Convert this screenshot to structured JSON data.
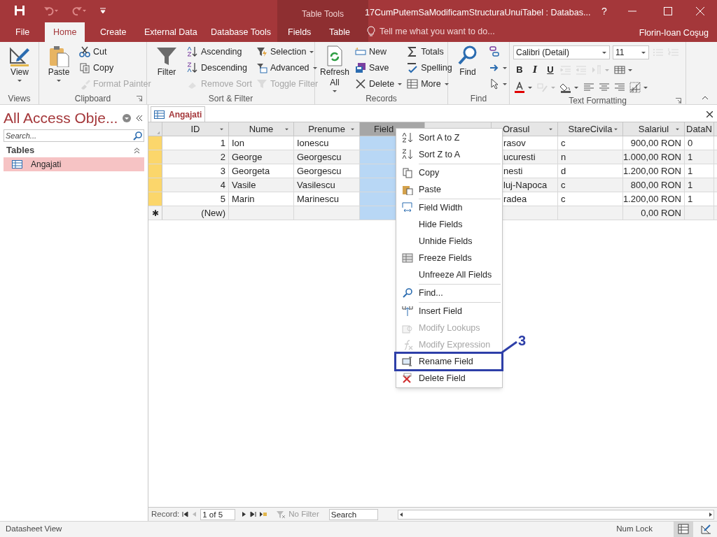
{
  "title_bar": {
    "title": "17CumPutemSaModificamStructuraUnuiTabel : Databas...",
    "contextual_group": "Table Tools",
    "help": "?"
  },
  "menu_tabs": [
    {
      "label": "File",
      "selected": false
    },
    {
      "label": "Home",
      "selected": true
    },
    {
      "label": "Create",
      "selected": false
    },
    {
      "label": "External Data",
      "selected": false
    },
    {
      "label": "Database Tools",
      "selected": false
    },
    {
      "label": "Fields",
      "selected": false
    },
    {
      "label": "Table",
      "selected": false
    }
  ],
  "tell_me": {
    "placeholder": "Tell me what you want to do..."
  },
  "user": "Florin-Ioan Coşug",
  "ribbon_groups": [
    {
      "label": "Views",
      "launcher": false,
      "stacks": [
        [
          {
            "kind": "large",
            "label": "View",
            "disabled": false,
            "dropdown": true
          }
        ]
      ]
    },
    {
      "label": "Clipboard",
      "launcher": true,
      "stacks": [
        [
          {
            "kind": "large",
            "label": "Paste",
            "disabled": false,
            "dropdown": true
          }
        ],
        [
          {
            "kind": "small",
            "label": "Cut",
            "disabled": false,
            "dropdown": false
          },
          {
            "kind": "small",
            "label": "Copy",
            "disabled": false,
            "dropdown": false
          },
          {
            "kind": "small",
            "label": "Format Painter",
            "disabled": true,
            "dropdown": false
          }
        ]
      ]
    },
    {
      "label": "Sort & Filter",
      "launcher": false,
      "stacks": [
        [
          {
            "kind": "large",
            "label": "Filter",
            "disabled": false,
            "dropdown": false
          }
        ],
        [
          {
            "kind": "small",
            "label": "Ascending",
            "disabled": false,
            "dropdown": false
          },
          {
            "kind": "small",
            "label": "Descending",
            "disabled": false,
            "dropdown": false
          },
          {
            "kind": "small",
            "label": "Remove Sort",
            "disabled": true,
            "dropdown": false
          }
        ],
        [
          {
            "kind": "small",
            "label": "Selection",
            "disabled": false,
            "dropdown": true
          },
          {
            "kind": "small",
            "label": "Advanced",
            "disabled": false,
            "dropdown": true
          },
          {
            "kind": "small",
            "label": "Toggle Filter",
            "disabled": true,
            "dropdown": false
          }
        ]
      ]
    },
    {
      "label": "Records",
      "launcher": false,
      "stacks": [
        [
          {
            "kind": "large",
            "label": "Refresh All",
            "disabled": false,
            "dropdown": true
          }
        ],
        [
          {
            "kind": "small",
            "label": "New",
            "disabled": false,
            "dropdown": false
          },
          {
            "kind": "small",
            "label": "Save",
            "disabled": false,
            "dropdown": false
          },
          {
            "kind": "small",
            "label": "Delete",
            "disabled": false,
            "dropdown": true
          }
        ],
        [
          {
            "kind": "small",
            "label": "Totals",
            "disabled": false,
            "dropdown": false
          },
          {
            "kind": "small",
            "label": "Spelling",
            "disabled": false,
            "dropdown": false
          },
          {
            "kind": "small",
            "label": "More",
            "disabled": false,
            "dropdown": true
          }
        ]
      ]
    },
    {
      "label": "Find",
      "launcher": false,
      "stacks": [
        [
          {
            "kind": "large",
            "label": "Find",
            "disabled": false,
            "dropdown": false
          }
        ],
        [
          {
            "kind": "icon",
            "disabled": false,
            "dropdown": false
          },
          {
            "kind": "icon",
            "disabled": false,
            "dropdown": true
          },
          {
            "kind": "icon",
            "disabled": false,
            "dropdown": true
          }
        ]
      ]
    },
    {
      "label": "Text Formatting",
      "launcher": true,
      "lines": [
        [
          {
            "kind": "combo",
            "value": "Calibri (Detail)"
          },
          {
            "kind": "combo",
            "value": "11"
          },
          {
            "kind": "icon",
            "disabled": true,
            "dropdown": false
          },
          {
            "kind": "icon",
            "disabled": true,
            "dropdown": false
          }
        ],
        [
          {
            "kind": "letter",
            "label": "B",
            "disabled": false
          },
          {
            "kind": "letter",
            "label": "I",
            "disabled": false
          },
          {
            "kind": "letter",
            "label": "U",
            "disabled": false
          },
          {
            "kind": "icon",
            "disabled": true,
            "dropdown": false
          },
          {
            "kind": "icon",
            "disabled": true,
            "dropdown": false
          },
          {
            "kind": "icon",
            "disabled": true,
            "dropdown": true
          },
          {
            "kind": "icon",
            "disabled": false,
            "dropdown": true
          }
        ],
        [
          {
            "kind": "icon",
            "disabled": false,
            "dropdown": true
          },
          {
            "kind": "icon",
            "disabled": true,
            "dropdown": true
          },
          {
            "kind": "icon",
            "disabled": false,
            "dropdown": true
          },
          {
            "kind": "icon",
            "disabled": false,
            "dropdown": false
          },
          {
            "kind": "icon",
            "disabled": false,
            "dropdown": false
          },
          {
            "kind": "icon",
            "disabled": false,
            "dropdown": false
          },
          {
            "kind": "icon",
            "disabled": false,
            "dropdown": true
          }
        ]
      ]
    }
  ],
  "nav_pane": {
    "title": "All Access Obje...",
    "search": {
      "placeholder": "Search..."
    },
    "sections": [
      {
        "label": "Tables",
        "expanded": true,
        "items": [
          {
            "label": "Angajati",
            "selected": true
          }
        ]
      }
    ]
  },
  "document_tab": {
    "label": "Angajati"
  },
  "table": {
    "columns": [
      {
        "label": "ID",
        "selected": false
      },
      {
        "label": "Nume",
        "selected": false
      },
      {
        "label": "Prenume",
        "selected": false
      },
      {
        "label": "Field",
        "selected": true
      },
      {
        "selected": false
      },
      {
        "label": "Orasul",
        "selected": false
      },
      {
        "label": "StareCivila",
        "selected": false
      },
      {
        "label": "Salariul",
        "selected": false
      },
      {
        "label": "DataN",
        "selected": false
      }
    ],
    "rows": [
      {
        "new": false,
        "cells": [
          "1",
          "Ion",
          "Ionescu",
          null,
          null,
          "rasov",
          "c",
          "900,00 RON",
          "0"
        ]
      },
      {
        "new": false,
        "cells": [
          "2",
          "George",
          "Georgescu",
          null,
          null,
          "ucuresti",
          "n",
          "1.000,00 RON",
          "1"
        ]
      },
      {
        "new": false,
        "cells": [
          "3",
          "Georgeta",
          "Georgescu",
          null,
          null,
          "nesti",
          "d",
          "1.200,00 RON",
          "1"
        ]
      },
      {
        "new": false,
        "cells": [
          "4",
          "Vasile",
          "Vasilescu",
          null,
          null,
          "luj-Napoca",
          "c",
          "800,00 RON",
          "1"
        ]
      },
      {
        "new": false,
        "cells": [
          "5",
          "Marin",
          "Marinescu",
          null,
          null,
          "radea",
          "c",
          "1.200,00 RON",
          "1"
        ]
      },
      {
        "new": true,
        "marker": "✱",
        "cells": [
          "(New)",
          null,
          null,
          null,
          null,
          null,
          null,
          "0,00 RON",
          null
        ]
      }
    ]
  },
  "context_menu": {
    "items": [
      {
        "kind": "item",
        "label": "Sort A to Z",
        "disabled": false
      },
      {
        "kind": "item",
        "label": "Sort Z to A",
        "disabled": false
      },
      {
        "kind": "separator"
      },
      {
        "kind": "item",
        "label": "Copy",
        "disabled": false
      },
      {
        "kind": "item",
        "label": "Paste",
        "disabled": false
      },
      {
        "kind": "separator"
      },
      {
        "kind": "item",
        "label": "Field Width",
        "disabled": false
      },
      {
        "kind": "item",
        "label": "Hide Fields",
        "disabled": false
      },
      {
        "kind": "item",
        "label": "Unhide Fields",
        "disabled": false
      },
      {
        "kind": "item",
        "label": "Freeze Fields",
        "disabled": false
      },
      {
        "kind": "item",
        "label": "Unfreeze All Fields",
        "disabled": false
      },
      {
        "kind": "separator"
      },
      {
        "kind": "item",
        "label": "Find...",
        "disabled": false
      },
      {
        "kind": "separator"
      },
      {
        "kind": "item",
        "label": "Insert Field",
        "disabled": false
      },
      {
        "kind": "item",
        "label": "Modify Lookups",
        "disabled": true
      },
      {
        "kind": "item",
        "label": "Modify Expression",
        "disabled": true
      },
      {
        "kind": "item",
        "label": "Rename Field",
        "disabled": false
      },
      {
        "kind": "item",
        "label": "Delete Field",
        "disabled": false
      }
    ]
  },
  "annotation": {
    "label": "3"
  },
  "record_nav": {
    "label": "Record:",
    "position": "1 of 5",
    "filter": "No Filter",
    "search": {
      "placeholder": "Search"
    }
  },
  "status_bar": {
    "view": "Datasheet View",
    "indicator": "Num Lock"
  }
}
